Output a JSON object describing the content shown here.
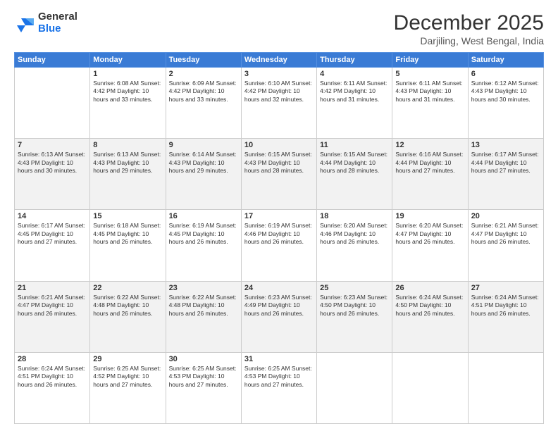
{
  "logo": {
    "general": "General",
    "blue": "Blue"
  },
  "header": {
    "month": "December 2025",
    "location": "Darjiling, West Bengal, India"
  },
  "days_of_week": [
    "Sunday",
    "Monday",
    "Tuesday",
    "Wednesday",
    "Thursday",
    "Friday",
    "Saturday"
  ],
  "weeks": [
    [
      {
        "day": "",
        "info": ""
      },
      {
        "day": "1",
        "info": "Sunrise: 6:08 AM\nSunset: 4:42 PM\nDaylight: 10 hours\nand 33 minutes."
      },
      {
        "day": "2",
        "info": "Sunrise: 6:09 AM\nSunset: 4:42 PM\nDaylight: 10 hours\nand 33 minutes."
      },
      {
        "day": "3",
        "info": "Sunrise: 6:10 AM\nSunset: 4:42 PM\nDaylight: 10 hours\nand 32 minutes."
      },
      {
        "day": "4",
        "info": "Sunrise: 6:11 AM\nSunset: 4:42 PM\nDaylight: 10 hours\nand 31 minutes."
      },
      {
        "day": "5",
        "info": "Sunrise: 6:11 AM\nSunset: 4:43 PM\nDaylight: 10 hours\nand 31 minutes."
      },
      {
        "day": "6",
        "info": "Sunrise: 6:12 AM\nSunset: 4:43 PM\nDaylight: 10 hours\nand 30 minutes."
      }
    ],
    [
      {
        "day": "7",
        "info": "Sunrise: 6:13 AM\nSunset: 4:43 PM\nDaylight: 10 hours\nand 30 minutes."
      },
      {
        "day": "8",
        "info": "Sunrise: 6:13 AM\nSunset: 4:43 PM\nDaylight: 10 hours\nand 29 minutes."
      },
      {
        "day": "9",
        "info": "Sunrise: 6:14 AM\nSunset: 4:43 PM\nDaylight: 10 hours\nand 29 minutes."
      },
      {
        "day": "10",
        "info": "Sunrise: 6:15 AM\nSunset: 4:43 PM\nDaylight: 10 hours\nand 28 minutes."
      },
      {
        "day": "11",
        "info": "Sunrise: 6:15 AM\nSunset: 4:44 PM\nDaylight: 10 hours\nand 28 minutes."
      },
      {
        "day": "12",
        "info": "Sunrise: 6:16 AM\nSunset: 4:44 PM\nDaylight: 10 hours\nand 27 minutes."
      },
      {
        "day": "13",
        "info": "Sunrise: 6:17 AM\nSunset: 4:44 PM\nDaylight: 10 hours\nand 27 minutes."
      }
    ],
    [
      {
        "day": "14",
        "info": "Sunrise: 6:17 AM\nSunset: 4:45 PM\nDaylight: 10 hours\nand 27 minutes."
      },
      {
        "day": "15",
        "info": "Sunrise: 6:18 AM\nSunset: 4:45 PM\nDaylight: 10 hours\nand 26 minutes."
      },
      {
        "day": "16",
        "info": "Sunrise: 6:19 AM\nSunset: 4:45 PM\nDaylight: 10 hours\nand 26 minutes."
      },
      {
        "day": "17",
        "info": "Sunrise: 6:19 AM\nSunset: 4:46 PM\nDaylight: 10 hours\nand 26 minutes."
      },
      {
        "day": "18",
        "info": "Sunrise: 6:20 AM\nSunset: 4:46 PM\nDaylight: 10 hours\nand 26 minutes."
      },
      {
        "day": "19",
        "info": "Sunrise: 6:20 AM\nSunset: 4:47 PM\nDaylight: 10 hours\nand 26 minutes."
      },
      {
        "day": "20",
        "info": "Sunrise: 6:21 AM\nSunset: 4:47 PM\nDaylight: 10 hours\nand 26 minutes."
      }
    ],
    [
      {
        "day": "21",
        "info": "Sunrise: 6:21 AM\nSunset: 4:47 PM\nDaylight: 10 hours\nand 26 minutes."
      },
      {
        "day": "22",
        "info": "Sunrise: 6:22 AM\nSunset: 4:48 PM\nDaylight: 10 hours\nand 26 minutes."
      },
      {
        "day": "23",
        "info": "Sunrise: 6:22 AM\nSunset: 4:48 PM\nDaylight: 10 hours\nand 26 minutes."
      },
      {
        "day": "24",
        "info": "Sunrise: 6:23 AM\nSunset: 4:49 PM\nDaylight: 10 hours\nand 26 minutes."
      },
      {
        "day": "25",
        "info": "Sunrise: 6:23 AM\nSunset: 4:50 PM\nDaylight: 10 hours\nand 26 minutes."
      },
      {
        "day": "26",
        "info": "Sunrise: 6:24 AM\nSunset: 4:50 PM\nDaylight: 10 hours\nand 26 minutes."
      },
      {
        "day": "27",
        "info": "Sunrise: 6:24 AM\nSunset: 4:51 PM\nDaylight: 10 hours\nand 26 minutes."
      }
    ],
    [
      {
        "day": "28",
        "info": "Sunrise: 6:24 AM\nSunset: 4:51 PM\nDaylight: 10 hours\nand 26 minutes."
      },
      {
        "day": "29",
        "info": "Sunrise: 6:25 AM\nSunset: 4:52 PM\nDaylight: 10 hours\nand 27 minutes."
      },
      {
        "day": "30",
        "info": "Sunrise: 6:25 AM\nSunset: 4:53 PM\nDaylight: 10 hours\nand 27 minutes."
      },
      {
        "day": "31",
        "info": "Sunrise: 6:25 AM\nSunset: 4:53 PM\nDaylight: 10 hours\nand 27 minutes."
      },
      {
        "day": "",
        "info": ""
      },
      {
        "day": "",
        "info": ""
      },
      {
        "day": "",
        "info": ""
      }
    ]
  ]
}
